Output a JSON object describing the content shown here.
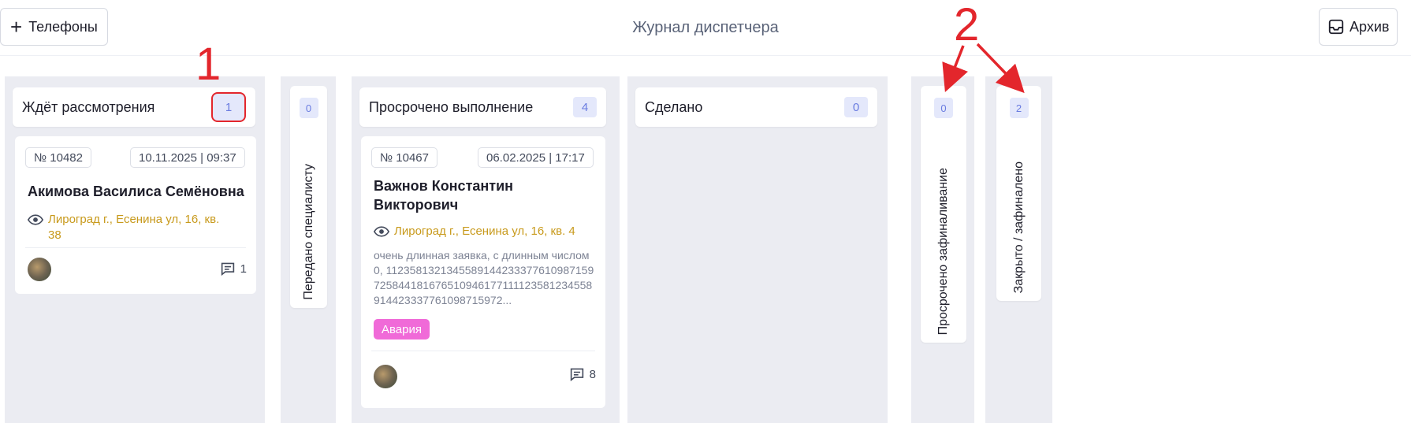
{
  "header": {
    "phones_label": "Телефоны",
    "title": "Журнал диспетчера",
    "archive_label": "Архив"
  },
  "columns": [
    {
      "title": "Ждёт рассмотрения",
      "count": "1",
      "card": {
        "number": "№ 10482",
        "datetime": "10.11.2025 | 09:37",
        "name": "Акимова Василиса Семёновна",
        "address": "Лироград г., Есенина ул, 16, кв. 38",
        "comments": "1"
      }
    },
    {
      "title": "Передано специалисту",
      "count": "0"
    },
    {
      "title": "Просрочено выполнение",
      "count": "4",
      "card": {
        "number": "№ 10467",
        "datetime": "06.02.2025 | 17:17",
        "name": "Важнов Константин Викторович",
        "address": "Лироград г., Есенина ул, 16, кв. 4",
        "description": "очень длинная заявка, с длинным числом 0, 1123581321345589144233377610987159725844181676510946177111123581234558914423337761098715972...",
        "tag": "Авария",
        "comments": "8"
      }
    },
    {
      "title": "Сделано",
      "count": "0"
    },
    {
      "title": "Просрочено зафиналивание",
      "count": "0"
    },
    {
      "title": "Закрыто / зафиналено",
      "count": "2"
    }
  ],
  "annotations": [
    "1",
    "2"
  ],
  "colors": {
    "accent": "#6a7ce0",
    "tag": "#f06ad8",
    "address": "#c89a1c",
    "annotation": "#e3262c"
  }
}
